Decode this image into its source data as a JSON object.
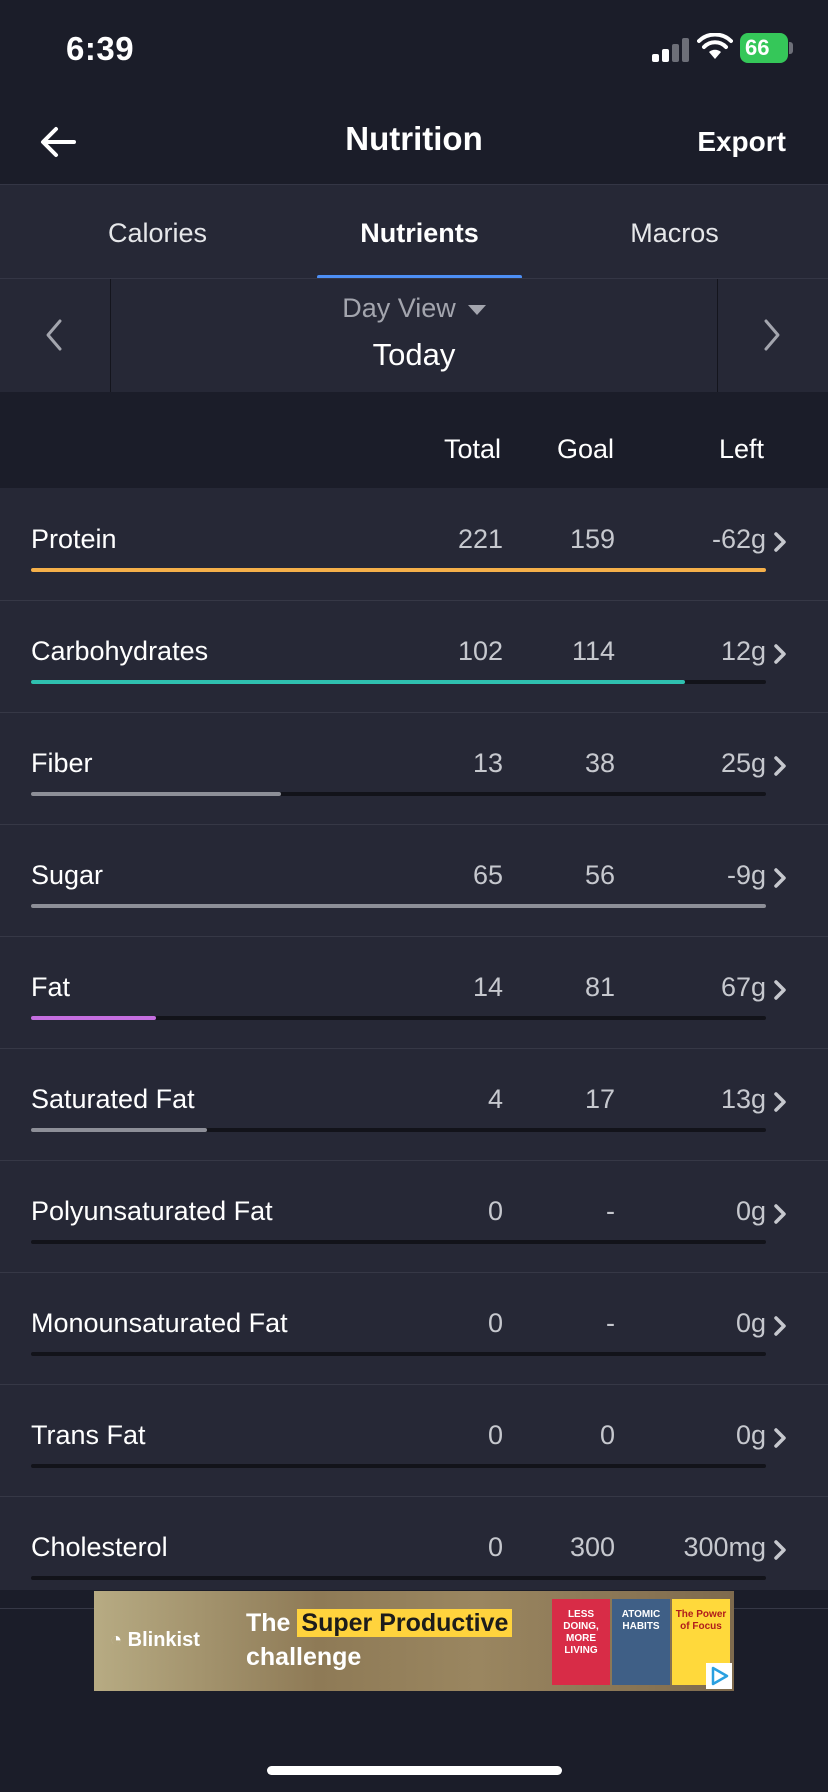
{
  "status_bar": {
    "time": "6:39",
    "battery": "66"
  },
  "nav": {
    "title": "Nutrition",
    "export": "Export"
  },
  "tabs": [
    {
      "label": "Calories",
      "active": false
    },
    {
      "label": "Nutrients",
      "active": true
    },
    {
      "label": "Macros",
      "active": false
    }
  ],
  "day": {
    "view": "Day View",
    "date": "Today"
  },
  "columns": {
    "total": "Total",
    "goal": "Goal",
    "left": "Left"
  },
  "nutrients": [
    {
      "name": "Protein",
      "total": "221",
      "goal": "159",
      "left": "-62g",
      "progress": 1.0,
      "color": "#f5b04a"
    },
    {
      "name": "Carbohydrates",
      "total": "102",
      "goal": "114",
      "left": "12g",
      "progress": 0.89,
      "color": "#2fc0b0"
    },
    {
      "name": "Fiber",
      "total": "13",
      "goal": "38",
      "left": "25g",
      "progress": 0.34,
      "color": "#8d8f98"
    },
    {
      "name": "Sugar",
      "total": "65",
      "goal": "56",
      "left": "-9g",
      "progress": 1.0,
      "color": "#8d8f98"
    },
    {
      "name": "Fat",
      "total": "14",
      "goal": "81",
      "left": "67g",
      "progress": 0.17,
      "color": "#c46ee0"
    },
    {
      "name": "Saturated Fat",
      "total": "4",
      "goal": "17",
      "left": "13g",
      "progress": 0.24,
      "color": "#8d8f98"
    },
    {
      "name": "Polyunsaturated Fat",
      "total": "0",
      "goal": "-",
      "left": "0g",
      "progress": 0,
      "color": "#8d8f98"
    },
    {
      "name": "Monounsaturated Fat",
      "total": "0",
      "goal": "-",
      "left": "0g",
      "progress": 0,
      "color": "#8d8f98"
    },
    {
      "name": "Trans Fat",
      "total": "0",
      "goal": "0",
      "left": "0g",
      "progress": 0,
      "color": "#8d8f98"
    },
    {
      "name": "Cholesterol",
      "total": "0",
      "goal": "300",
      "left": "300mg",
      "progress": 0,
      "color": "#8d8f98"
    }
  ],
  "ad": {
    "brand": "Blinkist",
    "headline_prefix": "The",
    "headline_highlight": "Super Productive",
    "headline_line2": "challenge",
    "books": [
      "LESS DOING, MORE LIVING",
      "ATOMIC HABITS",
      "The Power of Focus"
    ]
  }
}
